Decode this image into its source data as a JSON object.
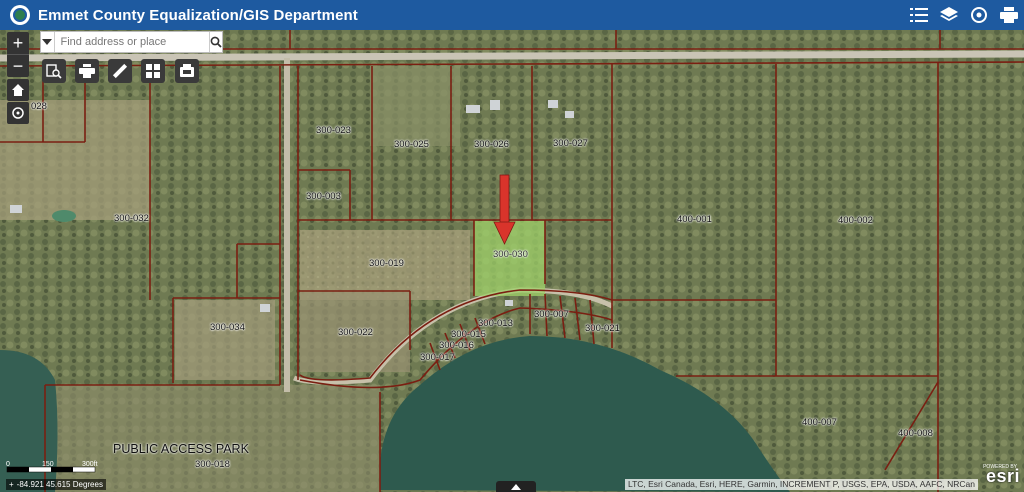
{
  "header": {
    "title": "Emmet County Equalization/GIS Department",
    "tools": [
      "legend-list-icon",
      "layers-icon",
      "basemap-gallery-icon",
      "print-icon"
    ]
  },
  "search": {
    "placeholder": "Find address or place"
  },
  "map_tools": [
    "zoom-in-icon",
    "zoom-out-icon",
    "home-icon",
    "locate-icon",
    "identify-icon",
    "print-icon",
    "measure-icon",
    "basemap-icon",
    "draw-icon"
  ],
  "zoom": {
    "in": "+",
    "out": "−"
  },
  "parcels": {
    "p028": "028",
    "p023": "300-023",
    "p025": "300-025",
    "p026": "300-026",
    "p027": "300-027",
    "p003": "300-003",
    "p032": "300-032",
    "p030": "300-030",
    "p019": "300-019",
    "p401": "400-001",
    "p402": "400-002",
    "p034": "300-034",
    "p022": "300-022",
    "p013": "300-013",
    "p015": "300-015",
    "p016": "300-016",
    "p017": "300-017",
    "p007": "300-007",
    "p021": "300-021",
    "p407": "400-007",
    "p408": "400-008",
    "p018": "300-018"
  },
  "park_label": "PUBLIC ACCESS PARK",
  "scale": {
    "a": "0",
    "b": "150",
    "c": "300ft"
  },
  "coordinates": "-84.921 45.615 Degrees",
  "attribution": "LTC, Esri Canada, Esri, HERE, Garmin, INCREMENT P, USGS, EPA, USDA, AAFC, NRCan",
  "esri": {
    "powered": "POWERED BY",
    "brand": "esri"
  },
  "colors": {
    "header": "#1e5aa0",
    "parcel_line": "#7a1f12",
    "selected_parcel": "#9fd26a",
    "arrow": "#d9342b",
    "lake": "#2e5a4e"
  }
}
